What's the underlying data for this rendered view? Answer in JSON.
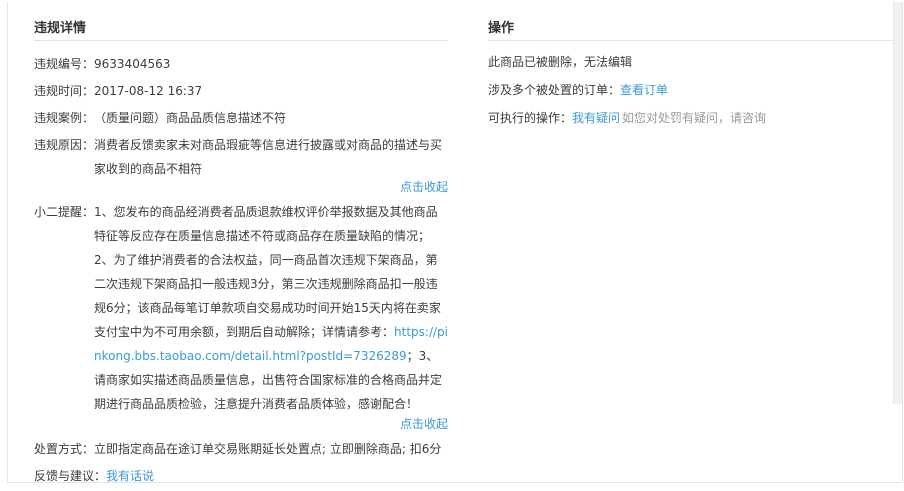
{
  "left": {
    "title": "违规详情",
    "id_label": "违规编号：",
    "id_value": "9633404563",
    "time_label": "违规时间：",
    "time_value": "2017-08-12 16:37",
    "case_label": "违规案例：",
    "case_value": "（质量问题）商品品质信息描述不符",
    "reason_label": "违规原因：",
    "reason_value": "消费者反馈卖家未对商品瑕疵等信息进行披露或对商品的描述与买家收到的商品不相符",
    "collapse_1": "点击收起",
    "tip_label": "小二提醒：",
    "tip_text_1": "1、您发布的商品经消费者品质退款维权评价举报数据及其他商品特征等反应存在质量信息描述不符或商品存在质量缺陷的情况；",
    "tip_text_2": "2、为了维护消费者的合法权益，同一商品首次违规下架商品，第二次违规下架商品扣一般违规3分，第三次违规删除商品扣一般违规6分；该商品每笔订单款项自交易成功时间开始15天内将在卖家支付宝中为不可用余额，到期后自动解除；详情请参考：",
    "tip_link": "https://pinkong.bbs.taobao.com/detail.html?postId=7326289",
    "tip_text_3": "；3、请商家如实描述商品质量信息，出售符合国家标准的合格商品并定期进行商品品质检验，注意提升消费者品质体验，感谢配合！",
    "collapse_2": "点击收起",
    "handle_label": "处置方式：",
    "handle_value": "立即指定商品在途订单交易账期延长处置点; 立即删除商品; 扣6分",
    "feedback_label": "反馈与建议：",
    "feedback_link": "我有话说"
  },
  "right": {
    "title": "操作",
    "deleted_notice": "此商品已被删除，无法编辑",
    "orders_text": "涉及多个被处置的订单：",
    "orders_link": "查看订单",
    "actions_label": "可执行的操作：",
    "actions_link": "我有疑问",
    "actions_hint": "如您对处罚有疑问，请咨询"
  }
}
